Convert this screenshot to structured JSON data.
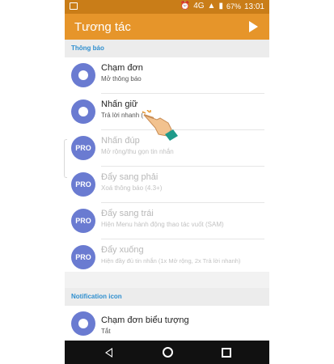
{
  "status_bar": {
    "network": "4G",
    "battery": "67%",
    "time": "13:01"
  },
  "app_bar": {
    "title": "Tương tác",
    "action_icon": "play-icon"
  },
  "sections": [
    {
      "header": "Thông báo",
      "items": [
        {
          "title": "Chạm đơn",
          "subtitle": "Mở thông báo",
          "pro": false
        },
        {
          "title": "Nhấn giữ",
          "subtitle": "Trả lời nhanh (",
          "pro": false
        },
        {
          "title": "Nhấn đúp",
          "subtitle": "Mở rộng/thu gọn tin nhắn",
          "pro": true,
          "badge": "PRO"
        },
        {
          "title": "Đẩy sang phải",
          "subtitle": "Xoá thông báo (4.3+)",
          "pro": true,
          "badge": "PRO"
        },
        {
          "title": "Đẩy sang trái",
          "subtitle": "Hiện Menu hành động thao tác vuốt (SAM)",
          "pro": true,
          "badge": "PRO"
        },
        {
          "title": "Đẩy xuống",
          "subtitle": "Hiện đầy đủ tin nhắn (1x Mở rộng, 2x Trả lời nhanh)",
          "pro": true,
          "badge": "PRO"
        }
      ]
    },
    {
      "header": "Notification icon",
      "items": [
        {
          "title": "Chạm đơn biểu tượng",
          "subtitle": "Tắt",
          "pro": false
        }
      ]
    }
  ],
  "colors": {
    "status_bar": "#c97d18",
    "app_bar": "#e6952a",
    "icon_circle": "#6a7bd1",
    "section_header_text": "#2f8fcf"
  }
}
